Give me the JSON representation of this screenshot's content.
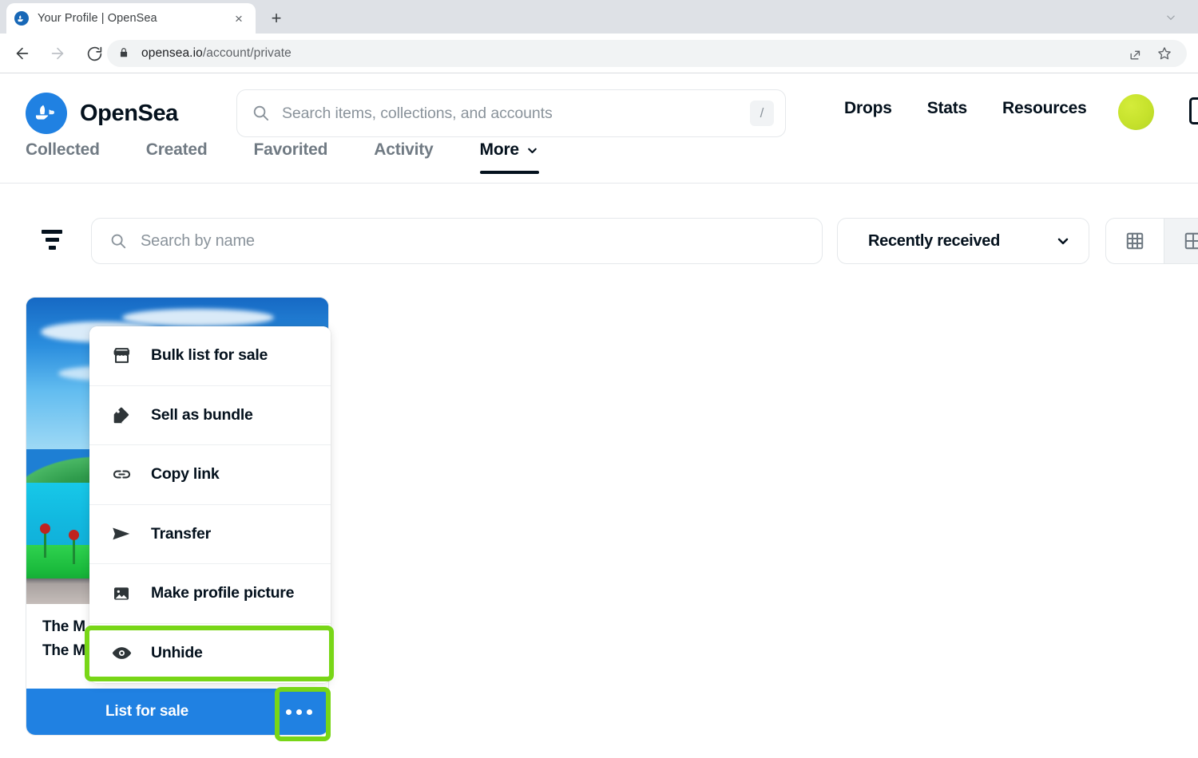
{
  "browser": {
    "tab": {
      "title": "Your Profile | OpenSea",
      "favicon": "opensea-favicon",
      "close_label": "×"
    },
    "new_tab_label": "+",
    "url": {
      "host": "opensea.io",
      "path": "/account/private",
      "full": "opensea.io/account/private"
    },
    "icons": {
      "back": "back-arrow-icon",
      "forward": "forward-arrow-icon",
      "reload": "reload-icon",
      "lock": "lock-icon",
      "share": "share-icon",
      "bookmark": "star-icon",
      "tabstrip_chevron": "chevron-down-icon"
    }
  },
  "header": {
    "brand": "OpenSea",
    "search": {
      "placeholder": "Search items, collections, and accounts",
      "value": "",
      "shortcut": "/"
    },
    "nav": [
      {
        "label": "Drops"
      },
      {
        "label": "Stats"
      },
      {
        "label": "Resources"
      }
    ],
    "avatar_color": "#c6e22c",
    "wallet_icon": "wallet-icon"
  },
  "profile_tabs": [
    {
      "label": "Collected",
      "active": false,
      "has_chevron": false
    },
    {
      "label": "Created",
      "active": false,
      "has_chevron": false
    },
    {
      "label": "Favorited",
      "active": false,
      "has_chevron": false
    },
    {
      "label": "Activity",
      "active": false,
      "has_chevron": false
    },
    {
      "label": "More",
      "active": true,
      "has_chevron": true
    }
  ],
  "toolbar": {
    "filter_icon": "filter-icon",
    "name_search": {
      "placeholder": "Search by name",
      "value": ""
    },
    "sort": {
      "value": "Recently received",
      "chevron": "chevron-down-icon"
    },
    "views": [
      {
        "name": "grid-view-small",
        "active": true
      },
      {
        "name": "grid-view-large",
        "active": false
      }
    ]
  },
  "card": {
    "title": "The M",
    "subtitle": "The M",
    "primary_action": "List for sale",
    "more_label": "•••",
    "button_color": "#2081e2"
  },
  "context_menu": {
    "items": [
      {
        "label": "Bulk list for sale",
        "icon": "storefront-icon",
        "highlighted": false
      },
      {
        "label": "Sell as bundle",
        "icon": "tag-icon",
        "highlighted": false
      },
      {
        "label": "Copy link",
        "icon": "link-icon",
        "highlighted": false
      },
      {
        "label": "Transfer",
        "icon": "send-icon",
        "highlighted": false
      },
      {
        "label": "Make profile picture",
        "icon": "image-icon",
        "highlighted": false
      },
      {
        "label": "Unhide",
        "icon": "eye-icon",
        "highlighted": true
      }
    ]
  },
  "annotations": {
    "highlight_color": "#78d617",
    "boxes": [
      {
        "target": "unhide-menu-item"
      },
      {
        "target": "card-more-button"
      }
    ]
  }
}
